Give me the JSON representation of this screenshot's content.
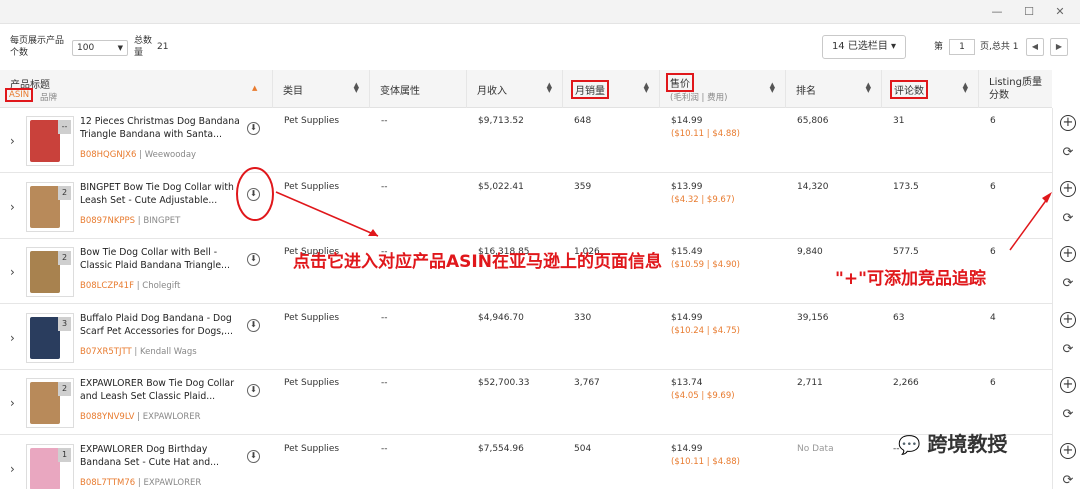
{
  "window": {
    "minimize": "—",
    "maximize": "☐",
    "close": "✕"
  },
  "toolbar": {
    "per_page_label": "每页展示产品个数",
    "per_page_value": "100",
    "total_label": "总数量",
    "total_value": "21",
    "columns_button": "14 已选栏目",
    "page_prefix": "第",
    "page_value": "1",
    "page_suffix": "页,总共 1"
  },
  "headers": {
    "product_title": "产品标题",
    "asin": "ASIN",
    "brand": "品牌",
    "category": "类目",
    "variant": "变体属性",
    "revenue": "月收入",
    "sales": "月销量",
    "price": "售价",
    "price_sub": "(毛利润 | 费用)",
    "rank": "排名",
    "reviews": "评论数",
    "listing_quality": "Listing质量分数"
  },
  "rows": [
    {
      "name": "12 Pieces Christmas Dog Bandana Triangle Bandana with Santa...",
      "asin": "B08HQGNJX6",
      "brand": "Weewooday",
      "count": "--",
      "category": "Pet Supplies",
      "variant": "--",
      "revenue": "$9,713.52",
      "sales": "648",
      "price": "$14.99",
      "margin": "($10.11 | $4.88)",
      "rank": "65,806",
      "reviews": "31",
      "quality": "6"
    },
    {
      "name": "BINGPET Bow Tie Dog Collar with Leash Set - Cute Adjustable...",
      "asin": "B0897NKPPS",
      "brand": "BINGPET",
      "count": "2",
      "category": "Pet Supplies",
      "variant": "--",
      "revenue": "$5,022.41",
      "sales": "359",
      "price": "$13.99",
      "margin": "($4.32 | $9.67)",
      "rank": "14,320",
      "reviews": "173.5",
      "quality": "6"
    },
    {
      "name": "Bow Tie Dog Collar with Bell - Classic Plaid Bandana Triangle...",
      "asin": "B08LCZP41F",
      "brand": "Cholegift",
      "count": "2",
      "category": "Pet Supplies",
      "variant": "--",
      "revenue": "$16,318.85",
      "sales": "1,026",
      "price": "$15.49",
      "margin": "($10.59 | $4.90)",
      "rank": "9,840",
      "reviews": "577.5",
      "quality": "6"
    },
    {
      "name": "Buffalo Plaid Dog Bandana - Dog Scarf Pet Accessories for Dogs,...",
      "asin": "B07XR5TJTT",
      "brand": "Kendall Wags",
      "count": "3",
      "category": "Pet Supplies",
      "variant": "--",
      "revenue": "$4,946.70",
      "sales": "330",
      "price": "$14.99",
      "margin": "($10.24 | $4.75)",
      "rank": "39,156",
      "reviews": "63",
      "quality": "4"
    },
    {
      "name": "EXPAWLORER Bow Tie Dog Collar and Leash Set Classic Plaid...",
      "asin": "B088YNV9LV",
      "brand": "EXPAWLORER",
      "count": "2",
      "category": "Pet Supplies",
      "variant": "--",
      "revenue": "$52,700.33",
      "sales": "3,767",
      "price": "$13.74",
      "margin": "($4.05 | $9.69)",
      "rank": "2,711",
      "reviews": "2,266",
      "quality": "6"
    },
    {
      "name": "EXPAWLORER Dog Birthday Bandana Set - Cute Hat and...",
      "asin": "B08L7TTM76",
      "brand": "EXPAWLORER",
      "count": "1",
      "category": "Pet Supplies",
      "variant": "--",
      "revenue": "$7,554.96",
      "sales": "504",
      "price": "$14.99",
      "margin": "($10.11 | $4.88)",
      "rank": "No Data",
      "reviews": "--",
      "quality": ""
    }
  ],
  "annotations": {
    "asin_note": "点击它进入对应产品ASIN在亚马逊上的页面信息",
    "plus_note": "\"+\"可添加竞品追踪",
    "watermark": "跨境教授"
  },
  "colors": {
    "accent": "#e87b2f",
    "annotation": "#e0171b"
  }
}
